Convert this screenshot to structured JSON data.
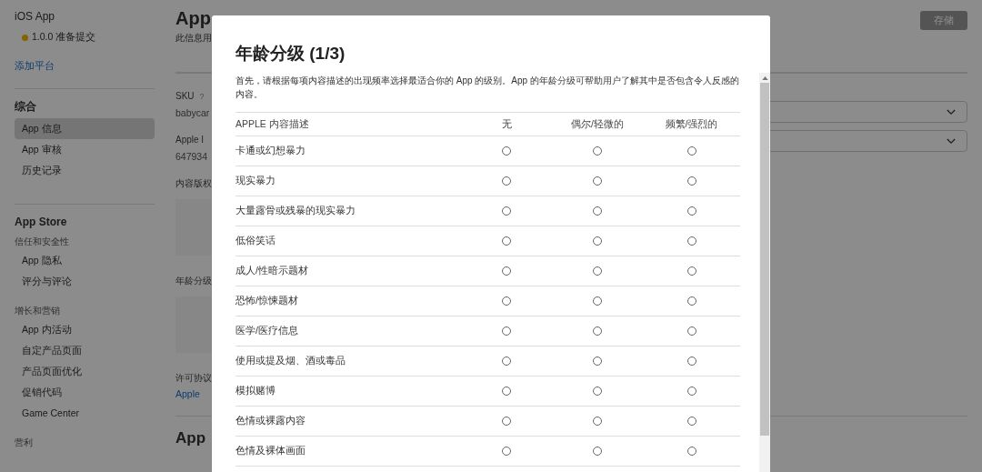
{
  "sidebar": {
    "app_title": "iOS App",
    "version": "1.0.0 准备提交",
    "add_platform": "添加平台",
    "groups": [
      {
        "title": "综合",
        "subgroups": [
          {
            "items": [
              {
                "label": "App 信息",
                "selected": true
              },
              {
                "label": "App 审核",
                "selected": false
              },
              {
                "label": "历史记录",
                "selected": false
              }
            ]
          }
        ]
      },
      {
        "title": "App Store",
        "subgroups": [
          {
            "title": "信任和安全性",
            "items": [
              {
                "label": "App 隐私",
                "selected": false
              },
              {
                "label": "评分与评论",
                "selected": false
              }
            ]
          },
          {
            "title": "增长和营销",
            "items": [
              {
                "label": "App 内活动",
                "selected": false
              },
              {
                "label": "自定产品页面",
                "selected": false
              },
              {
                "label": "产品页面优化",
                "selected": false
              },
              {
                "label": "促销代码",
                "selected": false
              },
              {
                "label": "Game Center",
                "selected": false
              }
            ]
          },
          {
            "title": "营利"
          }
        ]
      }
    ]
  },
  "main": {
    "title": "App",
    "subtitle": "此信息用",
    "save_button": {
      "label": "存储",
      "disabled": true
    },
    "fields": [
      {
        "kind": "value",
        "label": "SKU",
        "help": "?",
        "value": "babycar"
      },
      {
        "kind": "value",
        "label": "Apple I",
        "value": "647934"
      },
      {
        "kind": "panel",
        "label": "内容版权"
      },
      {
        "kind": "panel",
        "label": "年龄分级"
      },
      {
        "kind": "link",
        "label": "许可协议",
        "value": "Apple"
      }
    ],
    "dropdowns": [
      {
        "expanded": false
      },
      {
        "expanded": false
      }
    ],
    "section_title": "App"
  },
  "modal": {
    "title": "年龄分级 (1/3)",
    "description": "首先，请根据每项内容描述的出现频率选择最适合你的 App 的级别。App 的年龄分级可帮助用户了解其中是否包含令人反感的内容。",
    "columns": [
      "APPLE 内容描述",
      "无",
      "偶尔/轻微的",
      "频繁/强烈的"
    ],
    "rows": [
      {
        "label": "卡通或幻想暴力",
        "options": [
          {
            "selected": false
          },
          {
            "selected": false
          },
          {
            "selected": false
          }
        ]
      },
      {
        "label": "现实暴力",
        "options": [
          {
            "selected": false
          },
          {
            "selected": false
          },
          {
            "selected": false
          }
        ]
      },
      {
        "label": "大量露骨或残暴的现实暴力",
        "options": [
          {
            "selected": false
          },
          {
            "selected": false
          },
          {
            "selected": false
          }
        ]
      },
      {
        "label": "低俗笑话",
        "options": [
          {
            "selected": false
          },
          {
            "selected": false
          },
          {
            "selected": false
          }
        ]
      },
      {
        "label": "成人/性暗示题材",
        "options": [
          {
            "selected": false
          },
          {
            "selected": false
          },
          {
            "selected": false
          }
        ]
      },
      {
        "label": "恐怖/惊悚题材",
        "options": [
          {
            "selected": false
          },
          {
            "selected": false
          },
          {
            "selected": false
          }
        ]
      },
      {
        "label": "医学/医疗信息",
        "options": [
          {
            "selected": false
          },
          {
            "selected": false
          },
          {
            "selected": false
          }
        ]
      },
      {
        "label": "使用或提及烟、酒或毒品",
        "options": [
          {
            "selected": false
          },
          {
            "selected": false
          },
          {
            "selected": false
          }
        ]
      },
      {
        "label": "模拟赌博",
        "options": [
          {
            "selected": false
          },
          {
            "selected": false
          },
          {
            "selected": false
          }
        ]
      },
      {
        "label": "色情或裸露内容",
        "options": [
          {
            "selected": false
          },
          {
            "selected": false
          },
          {
            "selected": false
          }
        ]
      },
      {
        "label": "色情及裸体画面",
        "options": [
          {
            "selected": false
          },
          {
            "selected": false
          },
          {
            "selected": false
          }
        ]
      }
    ]
  }
}
